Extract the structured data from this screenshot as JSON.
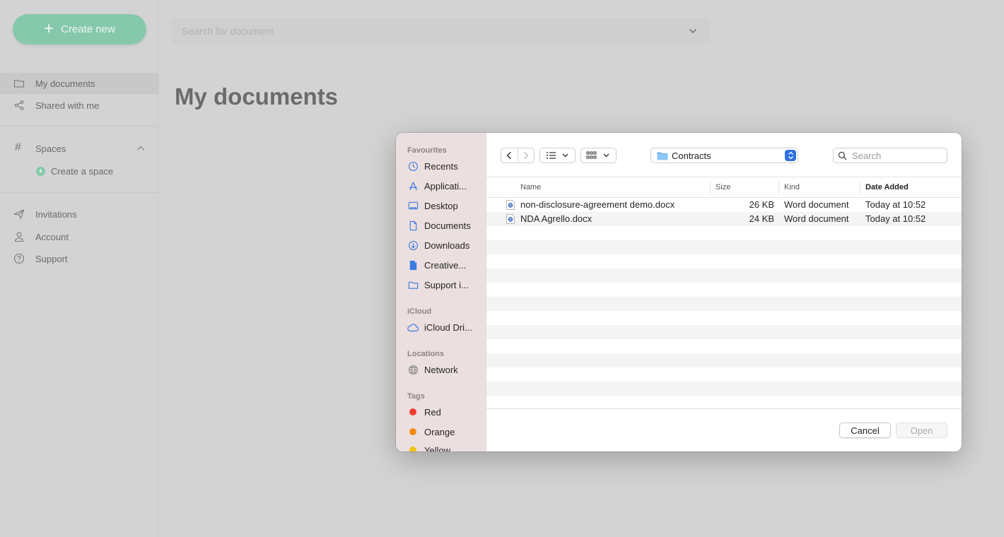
{
  "app": {
    "create_label": "Create new",
    "nav": [
      {
        "label": "My documents",
        "icon": "folder-icon"
      },
      {
        "label": "Shared with me",
        "icon": "share-icon"
      }
    ],
    "spaces_label": "Spaces",
    "create_space_label": "Create a space",
    "nav_bottom": [
      {
        "label": "Invitations",
        "icon": "paper-plane-icon"
      },
      {
        "label": "Account",
        "icon": "person-icon"
      },
      {
        "label": "Support",
        "icon": "question-circle-icon"
      }
    ],
    "search_placeholder": "Search for document",
    "page_title": "My documents",
    "accent_color": "#86c8ab"
  },
  "dialog": {
    "sidebar": {
      "favourites_title": "Favourites",
      "favourites": [
        {
          "label": "Recents",
          "icon": "clock-icon"
        },
        {
          "label": "Applicati...",
          "icon": "applications-icon"
        },
        {
          "label": "Desktop",
          "icon": "desktop-icon"
        },
        {
          "label": "Documents",
          "icon": "document-icon"
        },
        {
          "label": "Downloads",
          "icon": "download-icon"
        },
        {
          "label": "Creative...",
          "icon": "file-icon"
        },
        {
          "label": "Support i...",
          "icon": "folder-icon"
        }
      ],
      "icloud_title": "iCloud",
      "icloud": [
        {
          "label": "iCloud Dri...",
          "icon": "cloud-icon"
        }
      ],
      "locations_title": "Locations",
      "locations": [
        {
          "label": "Network",
          "icon": "globe-icon"
        }
      ],
      "tags_title": "Tags",
      "tags": [
        {
          "label": "Red",
          "color": "#ee3b30"
        },
        {
          "label": "Orange",
          "color": "#f08a12"
        },
        {
          "label": "Yellow",
          "color": "#f2c415"
        }
      ]
    },
    "location": "Contracts",
    "search_placeholder": "Search",
    "columns": {
      "name": "Name",
      "size": "Size",
      "kind": "Kind",
      "date": "Date Added"
    },
    "files": [
      {
        "name": "non-disclosure-agreement demo.docx",
        "size": "26 KB",
        "kind": "Word document",
        "date": "Today at 10:52"
      },
      {
        "name": "NDA Agrello.docx",
        "size": "24 KB",
        "kind": "Word document",
        "date": "Today at 10:52"
      }
    ],
    "cancel_label": "Cancel",
    "open_label": "Open"
  }
}
